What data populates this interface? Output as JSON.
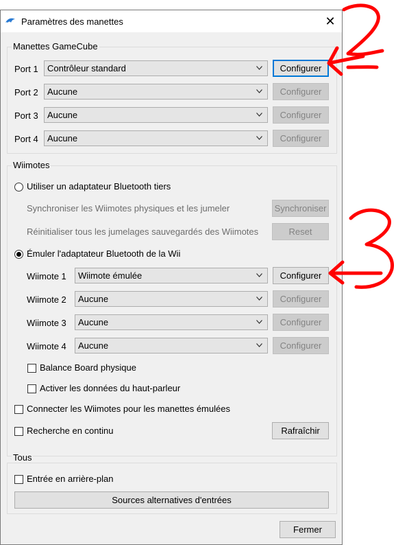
{
  "window": {
    "title": "Paramètres des manettes",
    "close_glyph": "✕"
  },
  "gamecube": {
    "title": "Manettes GameCube",
    "ports": [
      {
        "label": "Port 1",
        "value": "Contrôleur standard",
        "button": "Configurer",
        "enabled": true
      },
      {
        "label": "Port 2",
        "value": "Aucune",
        "button": "Configurer",
        "enabled": false
      },
      {
        "label": "Port 3",
        "value": "Aucune",
        "button": "Configurer",
        "enabled": false
      },
      {
        "label": "Port 4",
        "value": "Aucune",
        "button": "Configurer",
        "enabled": false
      }
    ]
  },
  "wiimotes": {
    "title": "Wiimotes",
    "third_party_radio": "Utiliser un adaptateur Bluetooth tiers",
    "sync_label": "Synchroniser les Wiimotes physiques et les jumeler",
    "sync_button": "Synchroniser",
    "reset_label": "Réinitialiser tous les jumelages sauvegardés des Wiimotes",
    "reset_button": "Reset",
    "emulate_radio": "Émuler l'adaptateur Bluetooth de la Wii",
    "slots": [
      {
        "label": "Wiimote 1",
        "value": "Wiimote émulée",
        "button": "Configurer",
        "enabled": true
      },
      {
        "label": "Wiimote 2",
        "value": "Aucune",
        "button": "Configurer",
        "enabled": false
      },
      {
        "label": "Wiimote 3",
        "value": "Aucune",
        "button": "Configurer",
        "enabled": false
      },
      {
        "label": "Wiimote 4",
        "value": "Aucune",
        "button": "Configurer",
        "enabled": false
      }
    ],
    "balance_board": "Balance Board physique",
    "speaker_data": "Activer les données du haut-parleur",
    "connect_emulated": "Connecter les Wiimotes pour les manettes émulées",
    "continuous_scan": "Recherche en continu",
    "refresh_button": "Rafraîchir"
  },
  "all": {
    "title": "Tous",
    "background_input": "Entrée en arrière-plan",
    "alt_sources_button": "Sources alternatives d'entrées"
  },
  "close_button": "Fermer",
  "annotations": {
    "color": "#ff0000",
    "marks": [
      "2",
      "3"
    ]
  }
}
